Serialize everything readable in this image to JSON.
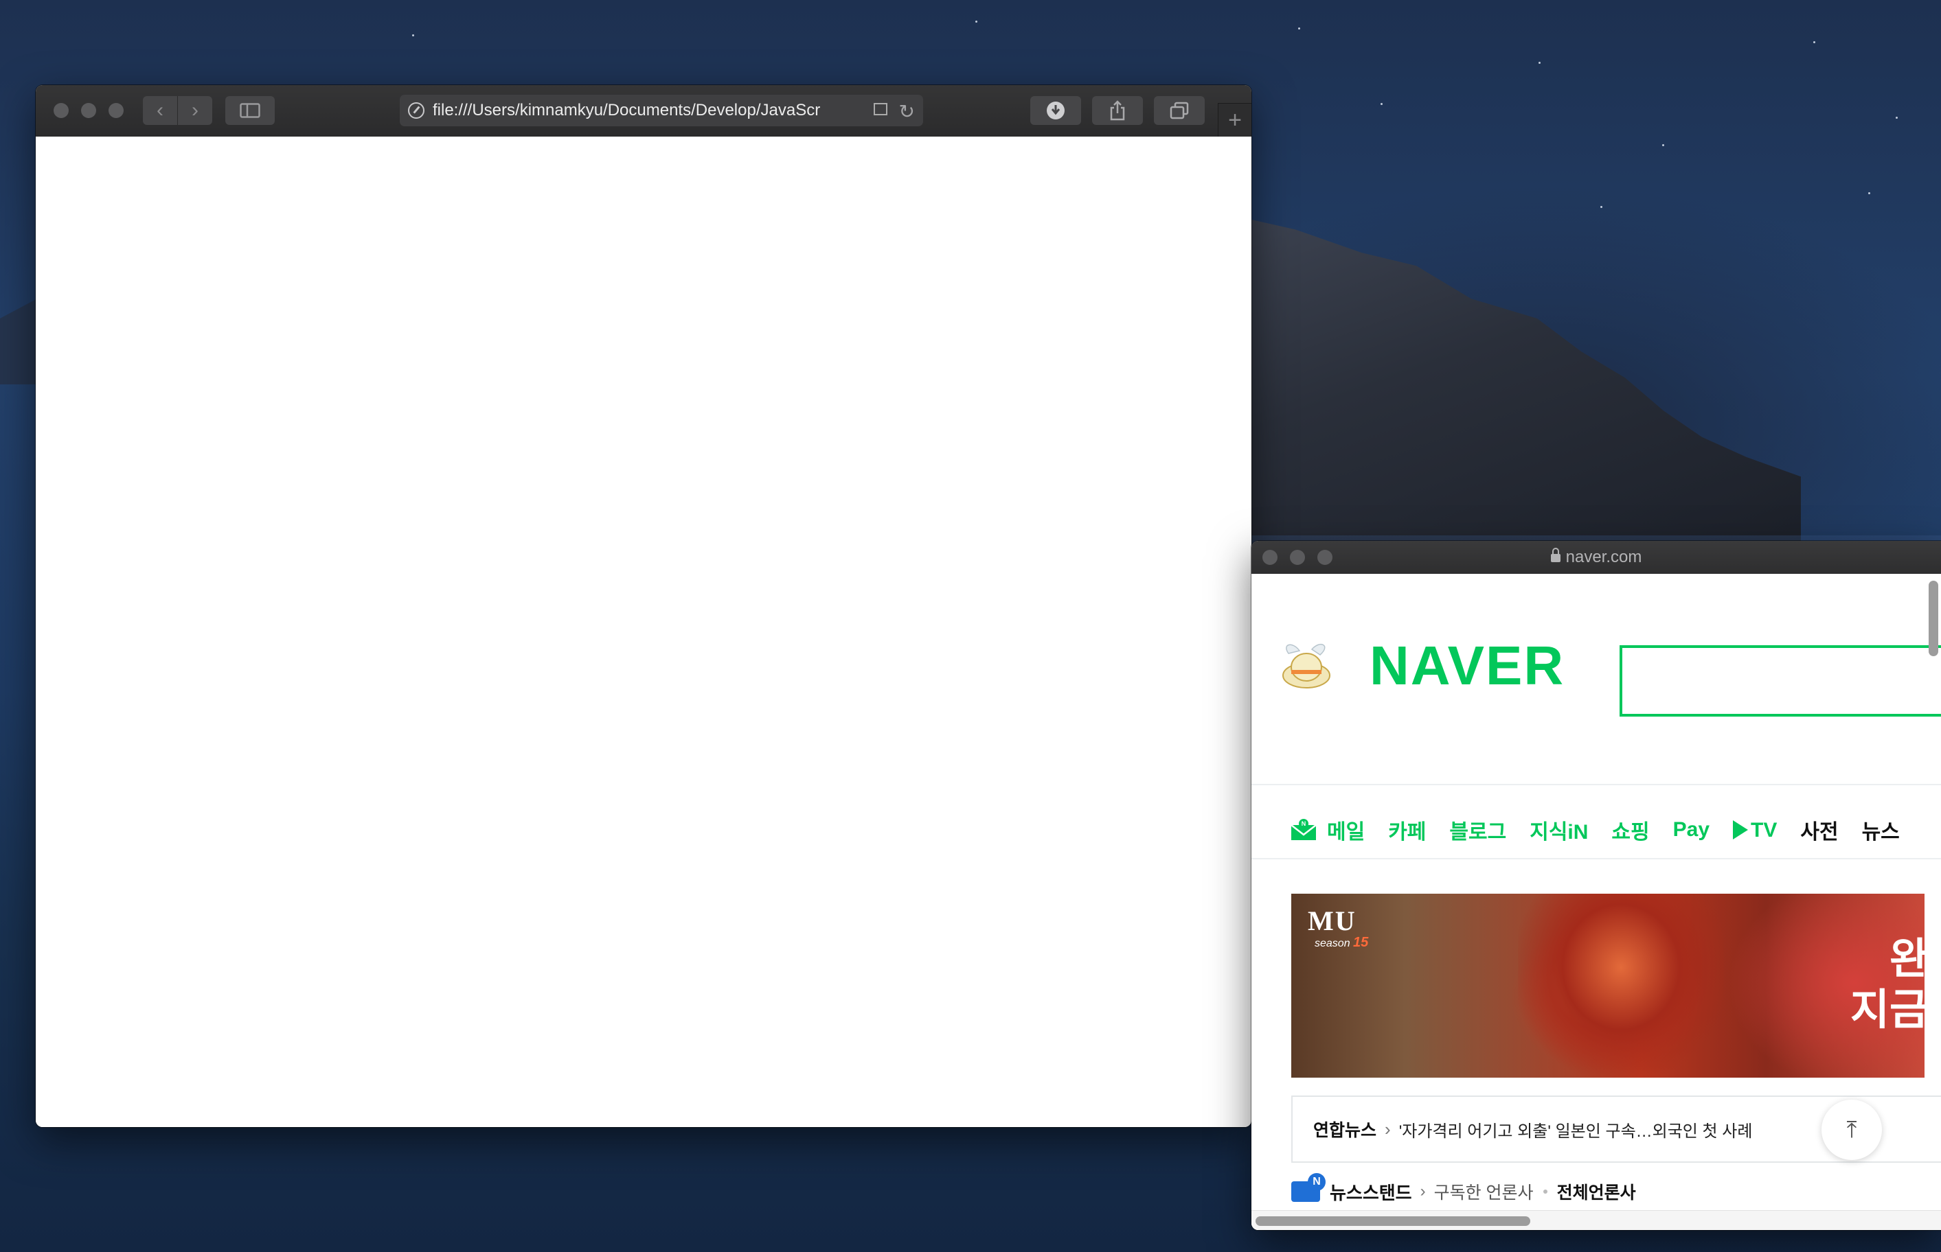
{
  "browser_main": {
    "url": "file:///Users/kimnamkyu/Documents/Develop/JavaScr",
    "back_icon": "chevron-left-icon",
    "forward_icon": "chevron-right-icon",
    "sidebar_icon": "sidebar-icon",
    "download_icon": "download-icon",
    "share_icon": "share-icon",
    "tabs_icon": "tabs-overview-icon",
    "new_tab_icon": "plus-icon"
  },
  "browser_naver": {
    "domain": "naver.com",
    "logo_text": "NAVER",
    "search_value": "",
    "nav_items": [
      "메일",
      "카페",
      "블로그",
      "지식iN",
      "쇼핑",
      "Pay",
      "TV",
      "사전",
      "뉴스"
    ],
    "banner": {
      "game_title": "MU",
      "season_label": "season",
      "season_number": "15",
      "cta_line1": "완",
      "cta_line2": "지금"
    },
    "news": {
      "source": "연합뉴스",
      "headline": "'자가격리 어기고 외출' 일본인 구속…외국인 첫 사례"
    },
    "newsstand": {
      "label": "뉴스스탠드",
      "subscribed": "구독한 언론사",
      "all": "전체언론사"
    }
  },
  "colors": {
    "naver_green": "#03c75a",
    "titlebar_dark": "#2b2b2c"
  }
}
